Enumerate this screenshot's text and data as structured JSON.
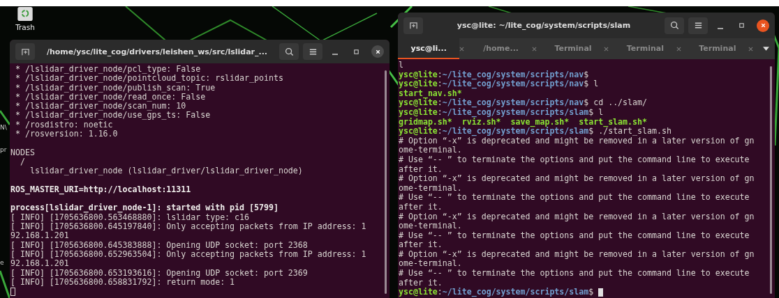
{
  "desktop": {
    "trash_label": "Trash",
    "edge_labels": [
      {
        "text": "N\\"
      },
      {
        "text": "pr"
      },
      {
        "text": "e"
      }
    ]
  },
  "windows": [
    {
      "title": "/home/ysc/lite_cog/drivers/leishen_ws/src/lslidar_...",
      "focused": false,
      "lines": [
        {
          "kind": "plain",
          "text": " * /lslidar_driver_node/pcl_type: False"
        },
        {
          "kind": "plain",
          "text": " * /lslidar_driver_node/pointcloud_topic: rslidar_points"
        },
        {
          "kind": "plain",
          "text": " * /lslidar_driver_node/publish_scan: True"
        },
        {
          "kind": "plain",
          "text": " * /lslidar_driver_node/read_once: False"
        },
        {
          "kind": "plain",
          "text": " * /lslidar_driver_node/scan_num: 10"
        },
        {
          "kind": "plain",
          "text": " * /lslidar_driver_node/use_gps_ts: False"
        },
        {
          "kind": "plain",
          "text": " * /rosdistro: noetic"
        },
        {
          "kind": "plain",
          "text": " * /rosversion: 1.16.0"
        },
        {
          "kind": "blank"
        },
        {
          "kind": "plain",
          "text": "NODES"
        },
        {
          "kind": "plain",
          "text": "  /"
        },
        {
          "kind": "plain",
          "text": "    lslidar_driver_node (lslidar_driver/lslidar_driver_node)"
        },
        {
          "kind": "blank"
        },
        {
          "kind": "bold",
          "text": "ROS_MASTER_URI=http://localhost:11311"
        },
        {
          "kind": "blank"
        },
        {
          "kind": "bold",
          "text": "process[lslidar_driver_node-1]: started with pid [5799]"
        },
        {
          "kind": "plain",
          "text": "[ INFO] [1705636800.563468880]: lslidar type: c16"
        },
        {
          "kind": "plain",
          "text": "[ INFO] [1705636800.645197840]: Only accepting packets from IP address: 1"
        },
        {
          "kind": "plain",
          "text": "92.168.1.201"
        },
        {
          "kind": "plain",
          "text": "[ INFO] [1705636800.645383888]: Opening UDP socket: port 2368"
        },
        {
          "kind": "plain",
          "text": "[ INFO] [1705636800.652963504]: Only accepting packets from IP address: 1"
        },
        {
          "kind": "plain",
          "text": "92.168.1.201"
        },
        {
          "kind": "plain",
          "text": "[ INFO] [1705636800.653193616]: Opening UDP socket: port 2369"
        },
        {
          "kind": "plain",
          "text": "[ INFO] [1705636800.658831792]: return mode: 1"
        },
        {
          "kind": "cursor"
        }
      ]
    },
    {
      "title": "ysc@lite: ~/lite_cog/system/scripts/slam",
      "focused": true,
      "tabs": [
        {
          "label": "ysc@li...",
          "selected": true
        },
        {
          "label": "/home...",
          "selected": false
        },
        {
          "label": "Terminal",
          "selected": false
        },
        {
          "label": "Terminal",
          "selected": false
        },
        {
          "label": "Terminal",
          "selected": false
        }
      ],
      "lines": [
        {
          "kind": "plain",
          "text": "l"
        },
        {
          "kind": "prompt",
          "user": "ysc@lite",
          "sep": ":",
          "path": "~/lite_cog/system/scripts/nav",
          "command": "$"
        },
        {
          "kind": "prompt",
          "user": "ysc@lite",
          "sep": ":",
          "path": "~/lite_cog/system/scripts/nav",
          "command": "$ l"
        },
        {
          "kind": "files",
          "text": "start_nav.sh*"
        },
        {
          "kind": "prompt",
          "user": "ysc@lite",
          "sep": ":",
          "path": "~/lite_cog/system/scripts/nav",
          "command": "$ cd ../slam/"
        },
        {
          "kind": "prompt",
          "user": "ysc@lite",
          "sep": ":",
          "path": "~/lite_cog/system/scripts/slam",
          "command": "$ l"
        },
        {
          "kind": "files",
          "text": "gridmap.sh*  rviz.sh*  save_map.sh*  start_slam.sh*"
        },
        {
          "kind": "prompt",
          "user": "ysc@lite",
          "sep": ":",
          "path": "~/lite_cog/system/scripts/slam",
          "command": "$ ./start_slam.sh"
        },
        {
          "kind": "plain",
          "text": "# Option “-x” is deprecated and might be removed in a later version of gn"
        },
        {
          "kind": "plain",
          "text": "ome-terminal."
        },
        {
          "kind": "plain",
          "text": "# Use “-- ” to terminate the options and put the command line to execute"
        },
        {
          "kind": "plain",
          "text": "after it."
        },
        {
          "kind": "plain",
          "text": "# Option “-x” is deprecated and might be removed in a later version of gn"
        },
        {
          "kind": "plain",
          "text": "ome-terminal."
        },
        {
          "kind": "plain",
          "text": "# Use “-- ” to terminate the options and put the command line to execute"
        },
        {
          "kind": "plain",
          "text": "after it."
        },
        {
          "kind": "plain",
          "text": "# Option “-x” is deprecated and might be removed in a later version of gn"
        },
        {
          "kind": "plain",
          "text": "ome-terminal."
        },
        {
          "kind": "plain",
          "text": "# Use “-- ” to terminate the options and put the command line to execute"
        },
        {
          "kind": "plain",
          "text": "after it."
        },
        {
          "kind": "plain",
          "text": "# Option “-x” is deprecated and might be removed in a later version of gn"
        },
        {
          "kind": "plain",
          "text": "ome-terminal."
        },
        {
          "kind": "plain",
          "text": "# Use “-- ” to terminate the options and put the command line to execute"
        },
        {
          "kind": "plain",
          "text": "after it."
        },
        {
          "kind": "prompt",
          "user": "ysc@lite",
          "sep": ":",
          "path": "~/lite_cog/system/scripts/slam",
          "command": "$ ",
          "cursor": true
        }
      ]
    }
  ]
}
